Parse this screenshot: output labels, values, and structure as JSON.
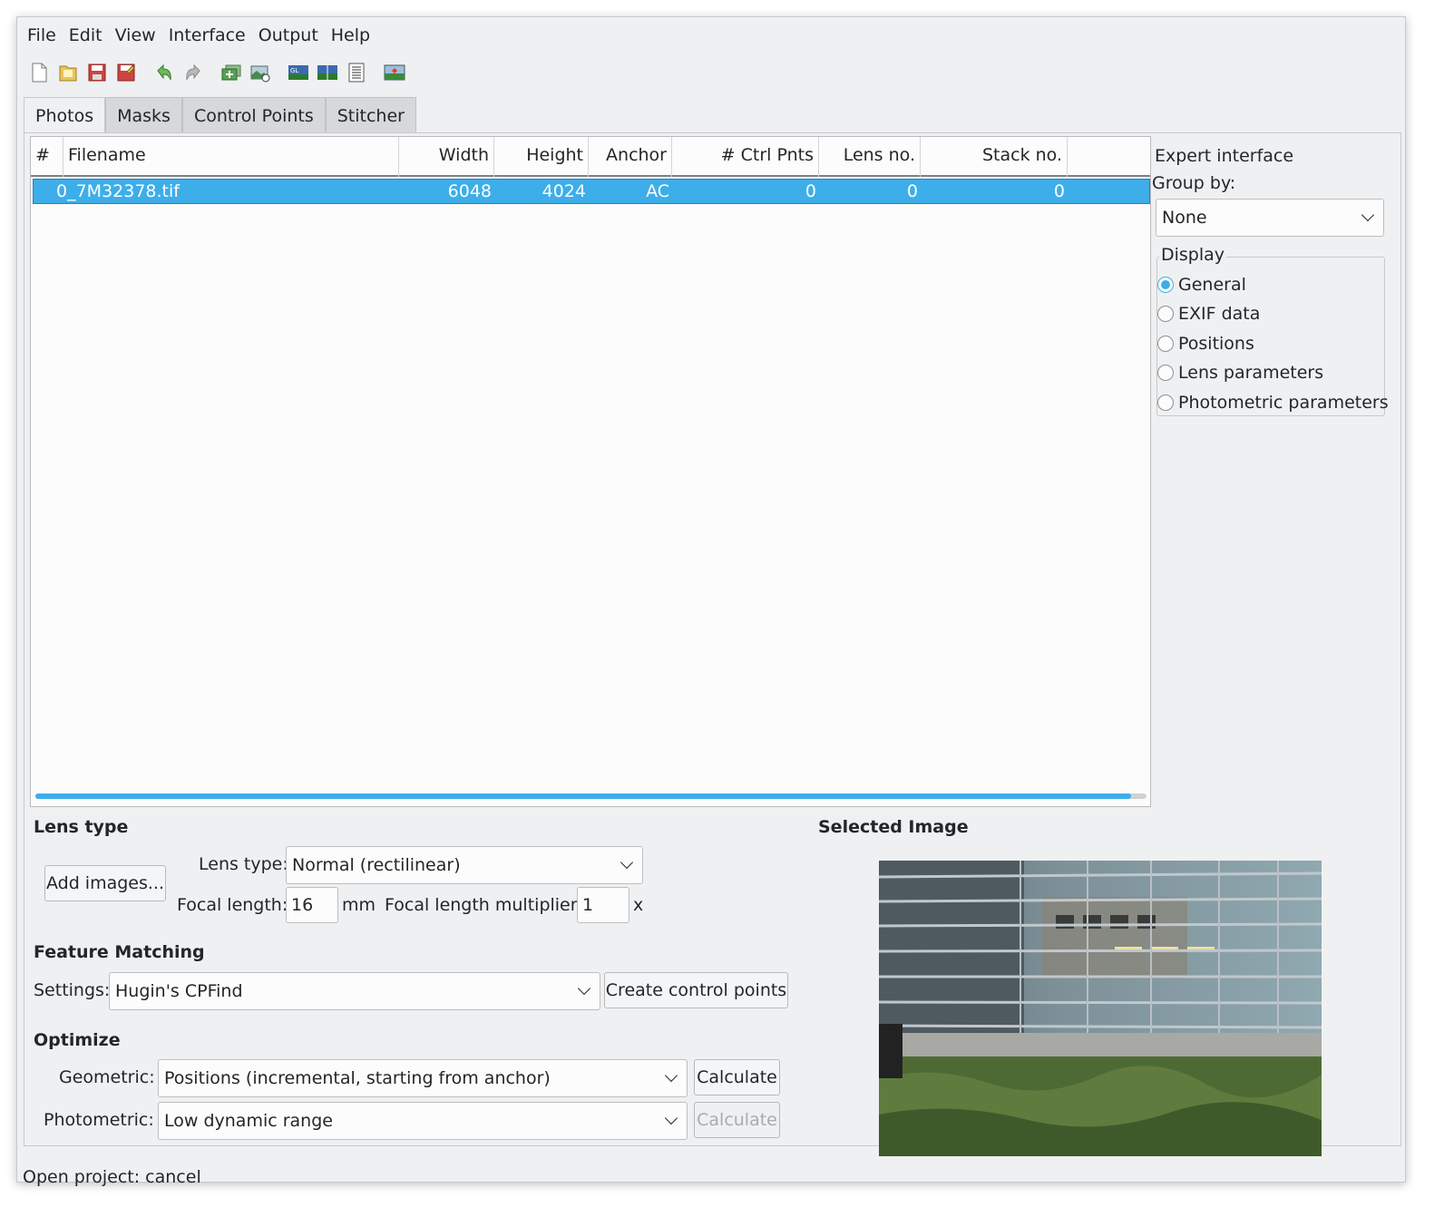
{
  "menubar": {
    "items": [
      "File",
      "Edit",
      "View",
      "Interface",
      "Output",
      "Help"
    ]
  },
  "toolbar": {
    "buttons": [
      "new-project-icon",
      "open-project-icon",
      "save-project-icon",
      "save-as-icon",
      "undo-icon",
      "redo-icon",
      "add-images-icon",
      "add-timed-images-icon",
      "fast-preview-gl-icon",
      "preview-icon",
      "optimize-icon",
      "stitch-icon"
    ]
  },
  "tabs": {
    "photos": "Photos",
    "masks": "Masks",
    "control_points": "Control Points",
    "stitcher": "Stitcher"
  },
  "table": {
    "headers": {
      "num": "#",
      "filename": "Filename",
      "width": "Width",
      "height": "Height",
      "anchor": "Anchor",
      "ctrl_pnts": "# Ctrl Pnts",
      "lens_no": "Lens no.",
      "stack_no": "Stack no."
    },
    "rows": [
      {
        "filename": "0_7M32378.tif",
        "width": "6048",
        "height": "4024",
        "anchor": "AC",
        "ctrl_pnts": "0",
        "lens_no": "0",
        "stack_no": "0"
      }
    ]
  },
  "side": {
    "expert_interface": "Expert interface",
    "group_by_label": "Group by:",
    "group_by_value": "None",
    "display_label": "Display",
    "display_options": {
      "general": "General",
      "exif": "EXIF data",
      "positions": "Positions",
      "lens": "Lens parameters",
      "photometric": "Photometric parameters"
    },
    "display_selected": "General"
  },
  "lens": {
    "title": "Lens type",
    "add_images": "Add images...",
    "lens_type_label": "Lens type:",
    "lens_type_value": "Normal (rectilinear)",
    "focal_length_label": "Focal length:",
    "focal_length_value": "16",
    "focal_length_unit": "mm",
    "multiplier_label": "Focal length multiplier:",
    "multiplier_value": "1",
    "multiplier_unit": "x"
  },
  "feature": {
    "title": "Feature Matching",
    "settings_label": "Settings:",
    "settings_value": "Hugin's CPFind",
    "create_cp": "Create control points"
  },
  "optimize": {
    "title": "Optimize",
    "geometric_label": "Geometric:",
    "geometric_value": "Positions (incremental, starting from anchor)",
    "geometric_calc": "Calculate",
    "photometric_label": "Photometric:",
    "photometric_value": "Low dynamic range",
    "photometric_calc": "Calculate"
  },
  "selected_image": {
    "title": "Selected Image"
  },
  "status": {
    "text": "Open project: cancel"
  }
}
